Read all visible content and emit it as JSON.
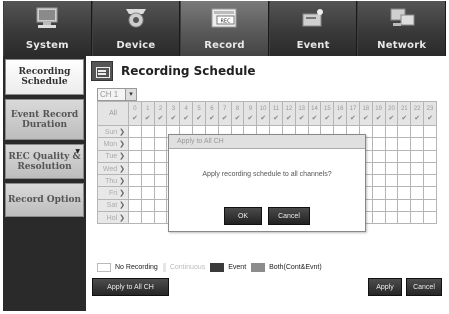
{
  "nav": {
    "tabs": [
      {
        "label": "System",
        "icon": "monitor-icon"
      },
      {
        "label": "Device",
        "icon": "camera-icon"
      },
      {
        "label": "Record",
        "icon": "recorder-icon",
        "badge": "REC",
        "active": true
      },
      {
        "label": "Event",
        "icon": "alarm-icon"
      },
      {
        "label": "Network",
        "icon": "network-icon"
      }
    ]
  },
  "sidebar": {
    "items": [
      {
        "label": "Recording Schedule",
        "active": true
      },
      {
        "label": "Event Record Duration"
      },
      {
        "label": "REC Quality & Resolution"
      },
      {
        "label": "Record Option"
      }
    ]
  },
  "page": {
    "title": "Recording Schedule",
    "channel": "CH 1",
    "all_label": "All",
    "hours": [
      "0",
      "1",
      "2",
      "3",
      "4",
      "5",
      "6",
      "7",
      "8",
      "9",
      "10",
      "11",
      "12",
      "13",
      "14",
      "15",
      "16",
      "17",
      "18",
      "19",
      "20",
      "21",
      "22",
      "23"
    ],
    "days": [
      "Sun",
      "Mon",
      "Tue",
      "Wed",
      "Thu",
      "Fri",
      "Sat",
      "Hol"
    ]
  },
  "dialog": {
    "title": "Apply to All CH",
    "message": "Apply recording schedule to all channels?",
    "ok": "OK",
    "cancel": "Cancel"
  },
  "legend": {
    "items": [
      {
        "label": "No Recording",
        "color": "#ffffff"
      },
      {
        "label": "Continuous",
        "color": "#e6e6e6"
      },
      {
        "label": "Event",
        "color": "#3a3a3a"
      },
      {
        "label": "Both(Cont&Evnt)",
        "color": "#8c8c8c"
      }
    ]
  },
  "buttons": {
    "apply_all": "Apply to All CH",
    "apply": "Apply",
    "cancel": "Cancel"
  }
}
